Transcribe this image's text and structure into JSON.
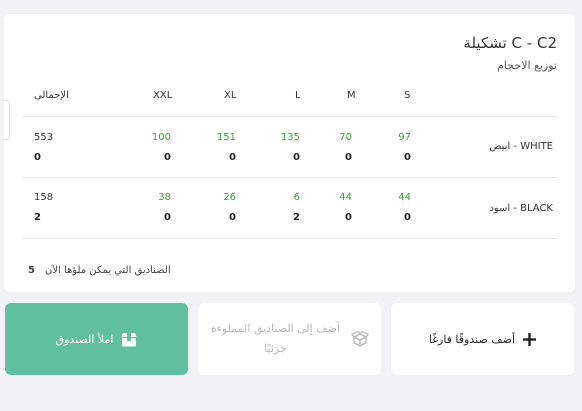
{
  "header": {
    "title": "تشكيلة C - C2",
    "subtitle": "توزيع الاحجام"
  },
  "table": {
    "columns": [
      "S",
      "M",
      "L",
      "XL",
      "XXL",
      "الإجمالى"
    ],
    "rows": [
      {
        "label": "ابيض - WHITE",
        "quantities": [
          "97",
          "70",
          "135",
          "151",
          "100"
        ],
        "quantity_total": "553",
        "boxes": [
          "0",
          "0",
          "0",
          "0",
          "0"
        ],
        "box_total": "0"
      },
      {
        "label": "اسود - BLACK",
        "quantities": [
          "44",
          "44",
          "6",
          "26",
          "38"
        ],
        "quantity_total": "158",
        "boxes": [
          "0",
          "0",
          "2",
          "0",
          "0"
        ],
        "box_total": "2"
      }
    ]
  },
  "footnote": {
    "text": "الصناديق التي يمكن ملؤها الآن",
    "count": "5"
  },
  "actions": {
    "fill_box": "املأ الصندوق",
    "add_partial": "أضف إلى الصناديق المملوءة جزئيًا",
    "add_empty": "أضف صندوقًا فارغًا"
  },
  "colors": {
    "background": "#f2f2f4",
    "primary_button": "#5fbf9e",
    "quantity_green": "#3a9a3a"
  }
}
